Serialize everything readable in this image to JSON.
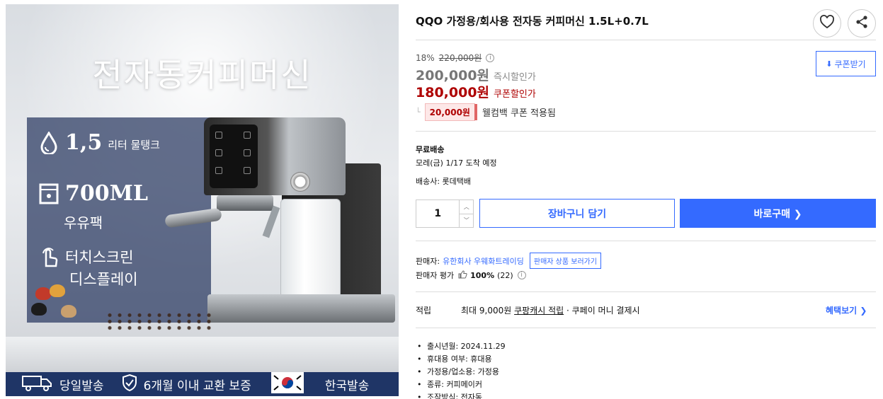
{
  "hero": {
    "title": "전자동커피머신",
    "feature_1_big": "1,5",
    "feature_1_small": "리터 물탱크",
    "feature_2_big": "700ML",
    "feature_2_sub": "우유팩",
    "feature_3_line1": "터치스크린",
    "feature_3_line2": "디스플레이",
    "bottom_bar": {
      "same_day": "당일발송",
      "exchange": "6개월 이내 교환 보증",
      "korea": "한국발송"
    }
  },
  "product": {
    "title": "QQO 가정용/회사용 전자동 커피머신 1.5L+0.7L"
  },
  "price": {
    "discount_rate": "18%",
    "original": "220,000원",
    "instant_price": "200,000원",
    "instant_label": "즉시할인가",
    "coupon_price": "180,000원",
    "coupon_label": "쿠폰할인가",
    "coupon_amount": "20,000원",
    "coupon_message": "웰컴백 쿠폰 적용됨",
    "coupon_button": "쿠폰받기"
  },
  "shipping": {
    "type": "무료배송",
    "arrival": "모레(금) 1/17 도착 예정",
    "carrier": "배송사: 롯데택배"
  },
  "purchase": {
    "quantity": "1",
    "cart_label": "장바구니 담기",
    "buy_label": "바로구매 ❯"
  },
  "seller": {
    "label": "판매자:",
    "name": "유한회사 우웨화트레이딩",
    "button": "판매자 상품 보러가기",
    "rating_label": "판매자 평가",
    "rating_value": "100%",
    "rating_count": "(22)"
  },
  "reward": {
    "label": "적립",
    "prefix": "최대 9,000원 ",
    "link": "쿠팡캐시 적립",
    "suffix": " · 쿠페이 머니 결제시",
    "benefit": "혜택보기 ❯"
  },
  "specs": [
    "출시년월: 2024.11.29",
    "휴대용 여부: 휴대용",
    "가정용/업소용: 가정용",
    "종류: 커피메이커",
    "조작방식: 전자동"
  ],
  "colors": {
    "accent_blue": "#346aff",
    "price_red": "#ae0000",
    "banner_navy": "#1f3566"
  }
}
